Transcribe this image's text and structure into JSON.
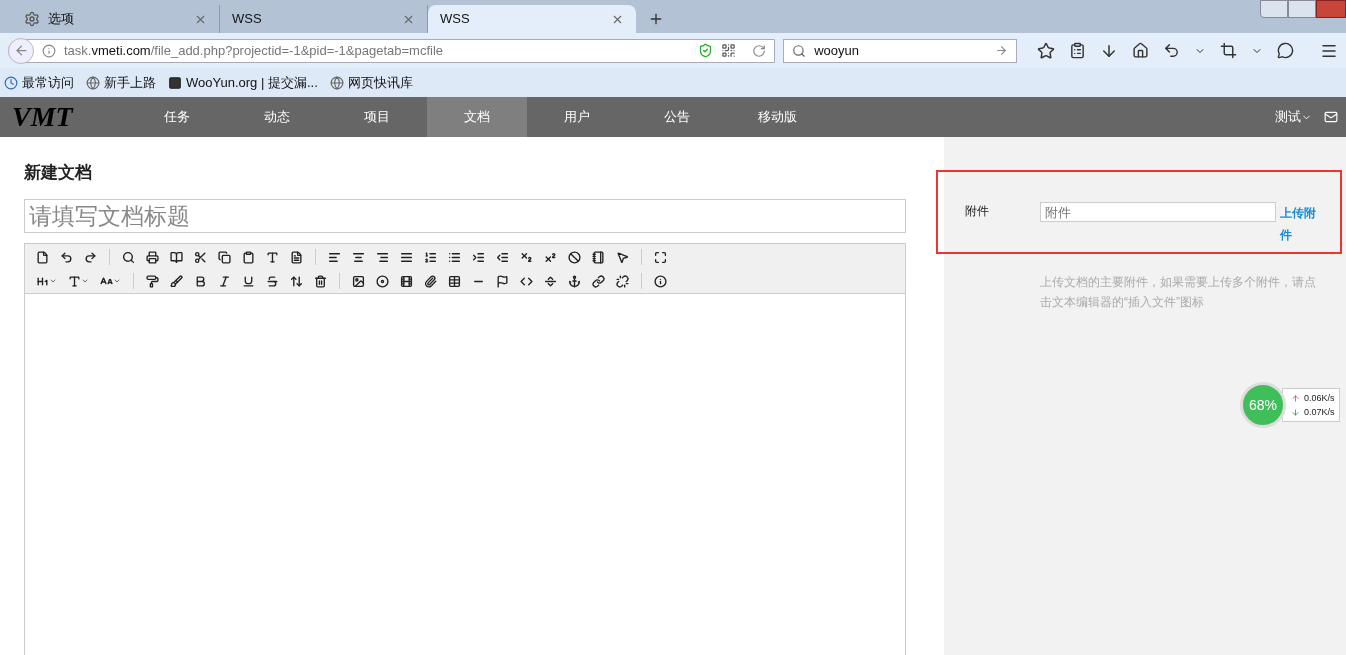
{
  "browser": {
    "tabs": [
      {
        "label": "选项",
        "kind": "settings",
        "selected": false
      },
      {
        "label": "WSS",
        "kind": "page",
        "selected": false
      },
      {
        "label": "WSS",
        "kind": "page",
        "selected": true
      }
    ],
    "url": {
      "prefix": "task.",
      "domain": "vmeti.com",
      "path": "/file_add.php?projectid=-1&pid=-1&pagetab=mcfile"
    },
    "search": {
      "value": "wooyun"
    },
    "bookmarks": [
      {
        "label": "最常访问",
        "kind": "recent"
      },
      {
        "label": "新手上路",
        "kind": "globe"
      },
      {
        "label": "WooYun.org | 提交漏...",
        "kind": "site"
      },
      {
        "label": "网页快讯库",
        "kind": "globe"
      }
    ]
  },
  "app": {
    "logo": "VMT",
    "nav": [
      {
        "label": "任务",
        "selected": false
      },
      {
        "label": "动态",
        "selected": false
      },
      {
        "label": "项目",
        "selected": false
      },
      {
        "label": "文档",
        "selected": true
      },
      {
        "label": "用户",
        "selected": false
      },
      {
        "label": "公告",
        "selected": false
      },
      {
        "label": "移动版",
        "selected": false
      }
    ],
    "user": "测试",
    "page_title": "新建文档",
    "title_field": {
      "placeholder": "请填写文档标题"
    },
    "attachment": {
      "label": "附件",
      "placeholder": "附件",
      "link": "上传附件",
      "hint": "上传文档的主要附件，如果需要上传多个附件，请点击文本编辑器的“插入文件”图标"
    }
  },
  "speed_widget": {
    "percent": "68%",
    "upload": "0.06K/s",
    "download": "0.07K/s"
  }
}
